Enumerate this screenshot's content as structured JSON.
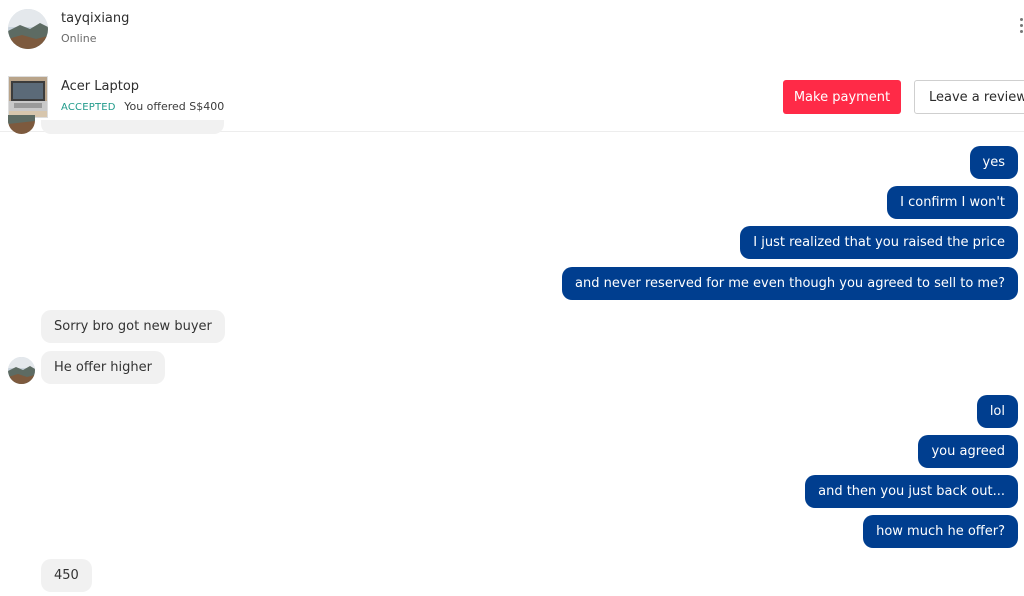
{
  "header": {
    "user_name": "tayqixiang",
    "status": "Online",
    "avatar_icon": "user-avatar-photo",
    "menu_icon": "more-vertical-icon"
  },
  "listing": {
    "title": "Acer Laptop",
    "status": "ACCEPTED",
    "offer": "You offered S$400",
    "thumb_icon": "laptop-photo",
    "pay_label": "Make payment",
    "review_label": "Leave a review",
    "accent_color": "#ff2a47",
    "accepted_color": "#1f9a8a"
  },
  "messages": [
    {
      "side": "out",
      "text": "yes"
    },
    {
      "side": "out",
      "text": "I confirm I won't"
    },
    {
      "side": "out",
      "text": "I just realized that you raised the price"
    },
    {
      "side": "out",
      "text": "and never reserved for me even though you agreed to sell to me?"
    },
    {
      "side": "in",
      "text": "Sorry bro got new buyer"
    },
    {
      "side": "in",
      "text": "He offer higher"
    },
    {
      "side": "out",
      "text": "lol"
    },
    {
      "side": "out",
      "text": "you agreed"
    },
    {
      "side": "out",
      "text": "and then you just back out..."
    },
    {
      "side": "out",
      "text": "how much he offer?"
    },
    {
      "side": "in",
      "text": "450"
    }
  ],
  "colors": {
    "outgoing_bubble": "#003e8f",
    "incoming_bubble": "#f1f1f1"
  }
}
